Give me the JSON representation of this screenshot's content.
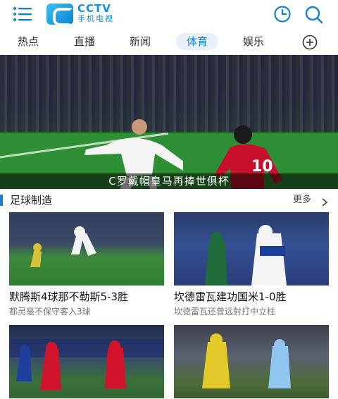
{
  "header": {
    "logo_text": "CCTV",
    "logo_sub": "手机电视"
  },
  "tabs": [
    {
      "label": "热点",
      "active": false
    },
    {
      "label": "直播",
      "active": false
    },
    {
      "label": "新闻",
      "active": false
    },
    {
      "label": "体育",
      "active": true
    },
    {
      "label": "娱乐",
      "active": false
    }
  ],
  "banner": {
    "caption": "C罗戴帽皇马再捧世俱杯",
    "slide_count": 5,
    "active_slide": 1
  },
  "section": {
    "title": "足球制造",
    "more_label": "更多"
  },
  "cards": [
    {
      "title": "默腾斯4球那不勒斯5-3胜",
      "subtitle": "都灵毫不保守客入3球"
    },
    {
      "title": "坎德雷瓦建功国米1-0胜",
      "subtitle": "坎德雷瓦还曾远射打中立柱"
    },
    {
      "title": "",
      "subtitle": ""
    },
    {
      "title": "",
      "subtitle": ""
    }
  ],
  "colors": {
    "accent": "#1a7fd4",
    "logo_blue": "#1090e0",
    "active_tab_bg": "#e8f1fa"
  },
  "icons": [
    "menu-icon",
    "cctv-logo",
    "history-clock-icon",
    "search-icon",
    "add-channel-icon",
    "chevron-right-icon"
  ]
}
